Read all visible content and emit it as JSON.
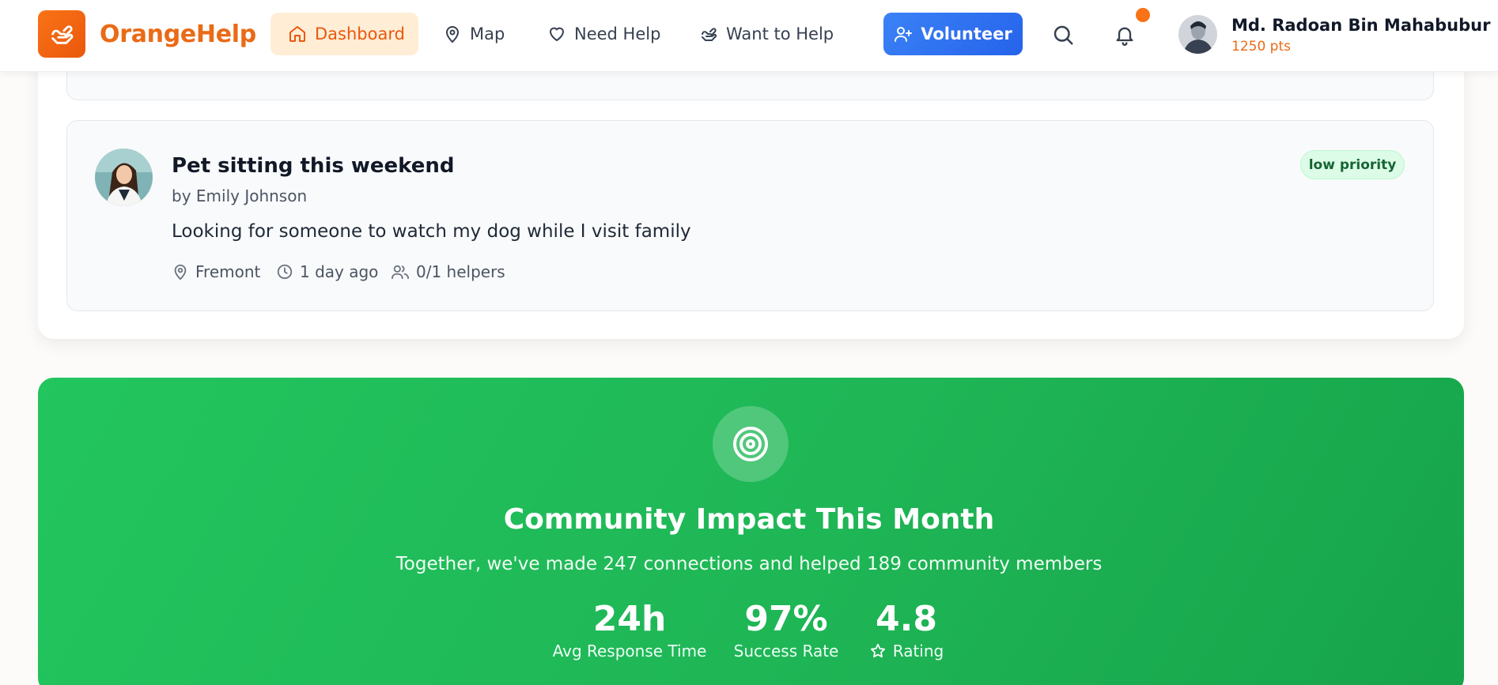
{
  "brand": {
    "name": "OrangeHelp",
    "accent": "#ea580c"
  },
  "nav": {
    "items": [
      {
        "label": "Dashboard",
        "icon": "home-icon",
        "active": true
      },
      {
        "label": "Map",
        "icon": "map-pin-icon",
        "active": false
      },
      {
        "label": "Need Help",
        "icon": "heart-icon",
        "active": false
      },
      {
        "label": "Want to Help",
        "icon": "helping-hand-icon",
        "active": false
      }
    ],
    "volunteer_label": "Volunteer"
  },
  "user": {
    "name": "Md. Radoan Bin Mahabubur",
    "points": "1250 pts"
  },
  "request": {
    "title": "Pet sitting this weekend",
    "author": "by Emily Johnson",
    "description": "Looking for someone to watch my dog while I visit family",
    "location": "Fremont",
    "time": "1 day ago",
    "helpers": "0/1 helpers",
    "priority": "low priority"
  },
  "impact": {
    "title": "Community Impact This Month",
    "subtitle": "Together, we've made 247 connections and helped 189 community members",
    "stats": [
      {
        "value": "24h",
        "label": "Avg Response Time"
      },
      {
        "value": "97%",
        "label": "Success Rate"
      },
      {
        "value": "4.8",
        "label": "Rating"
      }
    ]
  }
}
